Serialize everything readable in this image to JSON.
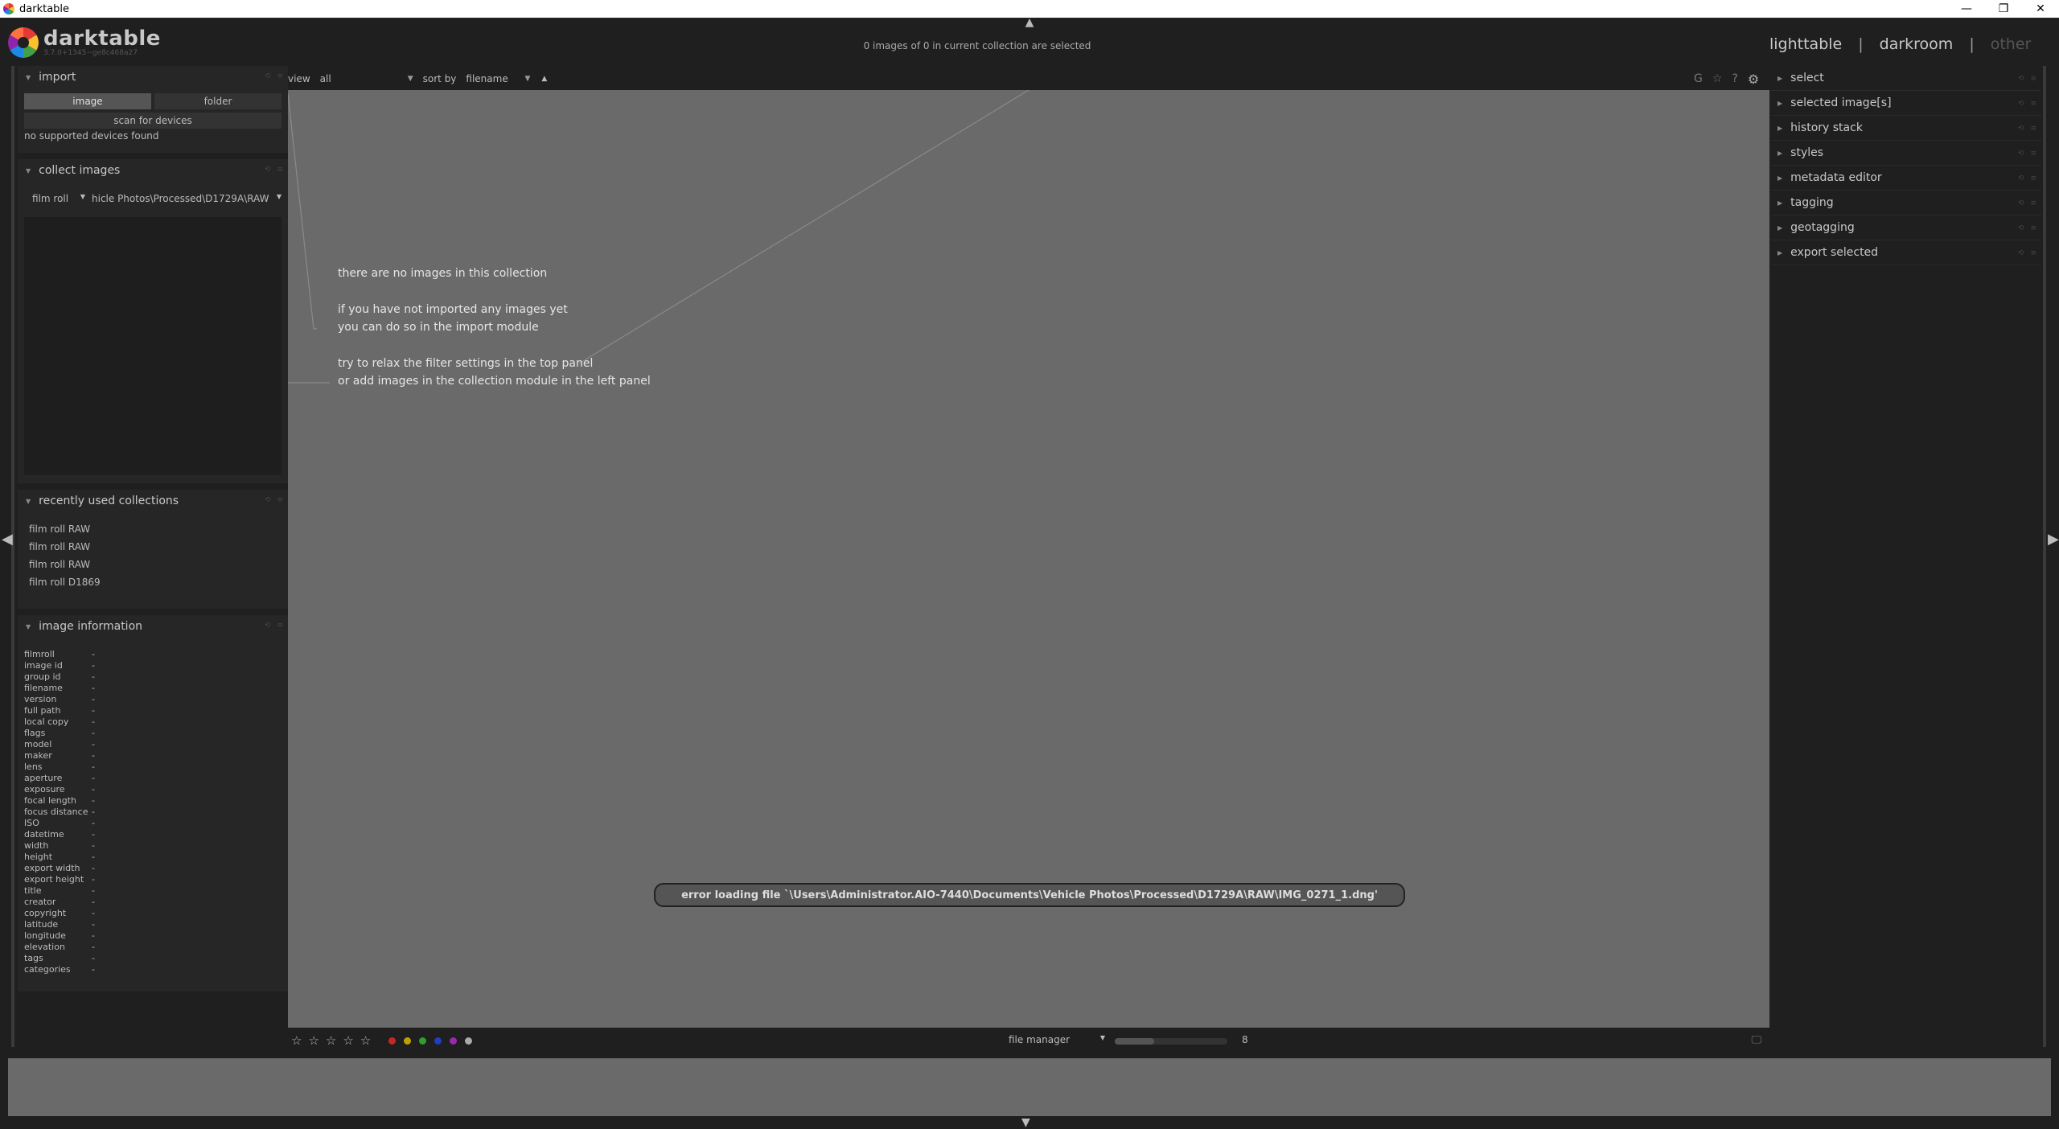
{
  "window": {
    "title": "darktable",
    "minimize": "—",
    "restore": "❐",
    "close": "✕"
  },
  "header": {
    "logo_name": "darktable",
    "logo_version": "3.7.0+1345~ge8c468a27",
    "selection_info": "0 images of 0 in current collection are selected",
    "views": {
      "lighttable": "lighttable",
      "darkroom": "darkroom",
      "other": "other",
      "sep": "|"
    }
  },
  "left": {
    "import": {
      "title": "import",
      "tab_image": "image",
      "tab_folder": "folder",
      "scan": "scan for devices",
      "no_devices": "no supported devices found"
    },
    "collect": {
      "title": "collect images",
      "property": "film roll",
      "value": "hicle Photos\\Processed\\D1729A\\RAW"
    },
    "recent": {
      "title": "recently used collections",
      "items": [
        "film roll RAW",
        "film roll RAW",
        "film roll RAW",
        "film roll D1869"
      ]
    },
    "info": {
      "title": "image information",
      "rows": [
        {
          "k": "filmroll",
          "v": "-"
        },
        {
          "k": "image id",
          "v": "-"
        },
        {
          "k": "group id",
          "v": "-"
        },
        {
          "k": "filename",
          "v": "-"
        },
        {
          "k": "version",
          "v": "-"
        },
        {
          "k": "full path",
          "v": "-"
        },
        {
          "k": "local copy",
          "v": "-"
        },
        {
          "k": "flags",
          "v": "-"
        },
        {
          "k": "model",
          "v": "-"
        },
        {
          "k": "maker",
          "v": "-"
        },
        {
          "k": "lens",
          "v": "-"
        },
        {
          "k": "aperture",
          "v": "-"
        },
        {
          "k": "exposure",
          "v": "-"
        },
        {
          "k": "focal length",
          "v": "-"
        },
        {
          "k": "focus distance",
          "v": "-"
        },
        {
          "k": "ISO",
          "v": "-"
        },
        {
          "k": "datetime",
          "v": "-"
        },
        {
          "k": "width",
          "v": "-"
        },
        {
          "k": "height",
          "v": "-"
        },
        {
          "k": "export width",
          "v": "-"
        },
        {
          "k": "export height",
          "v": "-"
        },
        {
          "k": "title",
          "v": "-"
        },
        {
          "k": "creator",
          "v": "-"
        },
        {
          "k": "copyright",
          "v": "-"
        },
        {
          "k": "latitude",
          "v": "-"
        },
        {
          "k": "longitude",
          "v": "-"
        },
        {
          "k": "elevation",
          "v": "-"
        },
        {
          "k": "tags",
          "v": "-"
        },
        {
          "k": "categories",
          "v": "-"
        }
      ]
    }
  },
  "center": {
    "view_label": "view",
    "view_value": "all",
    "sort_label": "sort by",
    "sort_value": "filename",
    "sort_dir": "▲",
    "hints": {
      "line1": "there are no images in this collection",
      "line2": "if you have not imported any images yet",
      "line3": "you can do so in the import module",
      "line4": "try to relax the filter settings in the top panel",
      "line5": "or add images in the collection module in the left panel"
    },
    "error": "error loading file `\\Users\\Administrator.AIO-7440\\Documents\\Vehicle Photos\\Processed\\D1729A\\RAW\\IMG_0271_1.dng'"
  },
  "bottom": {
    "layout": "file manager",
    "zoom": "8",
    "zoom_level": 0.35,
    "label_colors": [
      "#c62828",
      "#c0a000",
      "#2e9e2e",
      "#1e3fbf",
      "#9c27b0",
      "#aaaaaa"
    ]
  },
  "right": {
    "modules": [
      "select",
      "selected image[s]",
      "history stack",
      "styles",
      "metadata editor",
      "tagging",
      "geotagging",
      "export selected"
    ]
  }
}
